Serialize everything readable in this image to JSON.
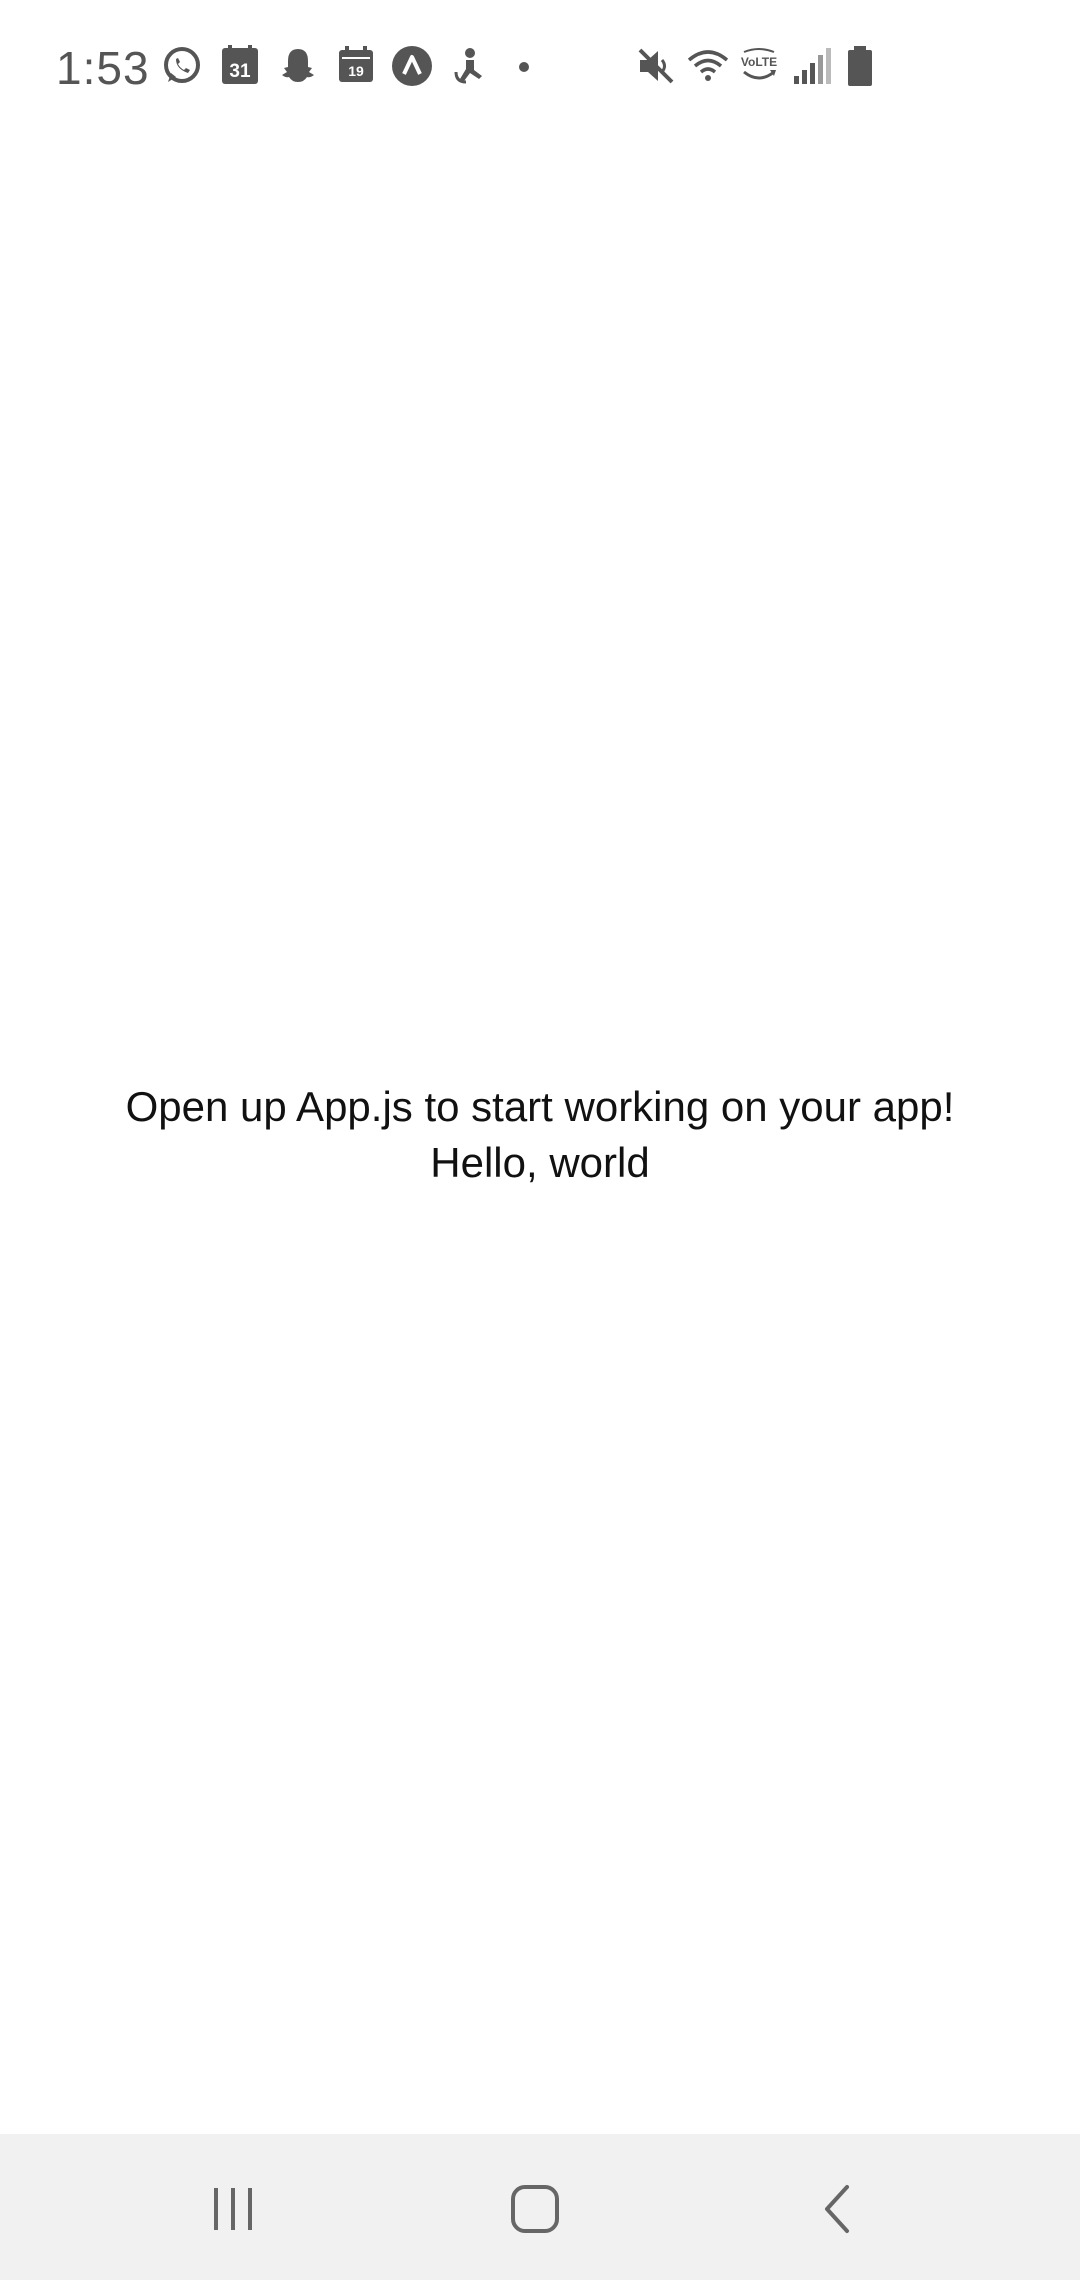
{
  "status_bar": {
    "time": "1:53",
    "calendar_day_1": "31",
    "calendar_day_2": "19",
    "network_badge": "VoLTE",
    "notification_icons": [
      "whatsapp-icon",
      "google-calendar-icon",
      "snapchat-icon",
      "calendar-icon",
      "expo-icon",
      "accessibility-icon",
      "more-dot-icon"
    ],
    "system_icons": [
      "mute-icon",
      "wifi-icon",
      "volte-icon",
      "signal-icon",
      "battery-icon"
    ],
    "icon_color": "#555555"
  },
  "main": {
    "message": "Open up App.js to start working on your app!",
    "greeting": "Hello, world"
  },
  "nav_bar": {
    "buttons": [
      "recent-apps",
      "home",
      "back"
    ],
    "background": "#f1f1f1"
  }
}
